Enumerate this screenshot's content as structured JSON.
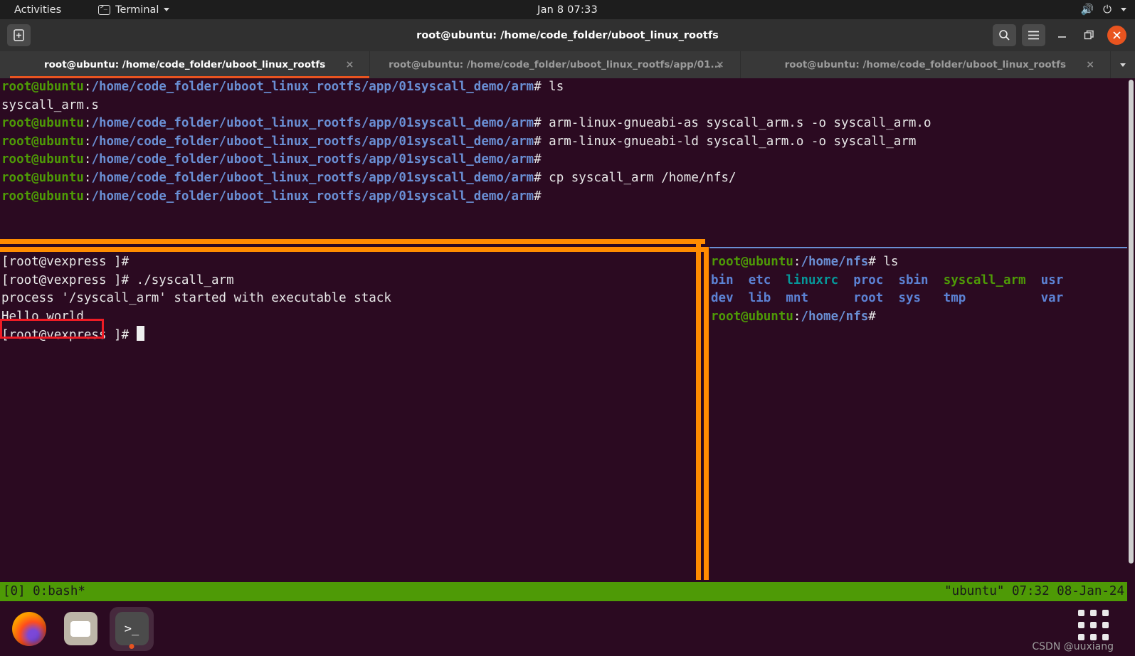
{
  "topbar": {
    "activities": "Activities",
    "app_name": "Terminal",
    "clock": "Jan 8 07:33",
    "volume_icon": "volume-icon",
    "power_icon": "power-icon",
    "caret_icon": "chevron-down-icon"
  },
  "window": {
    "title": "root@ubuntu: /home/code_folder/uboot_linux_rootfs",
    "new_tab_label": "+",
    "search_icon": "search-icon",
    "menu_icon": "hamburger-menu-icon",
    "minimize_label": "–",
    "maximize_label": "❐",
    "close_label": "✕",
    "accent_color": "#e95420"
  },
  "tabs": [
    {
      "label": "root@ubuntu: /home/code_folder/uboot_linux_rootfs",
      "close": "×",
      "active": true
    },
    {
      "label": "root@ubuntu: /home/code_folder/uboot_linux_rootfs/app/01...",
      "close": "×",
      "active": false
    },
    {
      "label": "root@ubuntu: /home/code_folder/uboot_linux_rootfs",
      "close": "×",
      "active": false
    }
  ],
  "tab_overflow_icon": "chevron-down-icon",
  "terminal": {
    "user_host": "root@ubuntu",
    "colon": ":",
    "path_host": "/home/code_folder/uboot_linux_rootfs/app/01syscall_demo/arm",
    "prompt_sym": "# ",
    "scrollback": [
      {
        "type": "prompt",
        "command": "ls"
      },
      {
        "type": "output",
        "text": "syscall_arm.s"
      },
      {
        "type": "prompt",
        "command": "arm-linux-gnueabi-as syscall_arm.s -o syscall_arm.o"
      },
      {
        "type": "prompt",
        "command": "arm-linux-gnueabi-ld syscall_arm.o -o syscall_arm"
      },
      {
        "type": "prompt",
        "command": ""
      },
      {
        "type": "prompt",
        "command": "cp syscall_arm /home/nfs/"
      },
      {
        "type": "prompt",
        "command": ""
      }
    ]
  },
  "pane_left": {
    "prompt": "[root@vexpress ]#",
    "lines": [
      {
        "prompt": "[root@vexpress ]#",
        "command": ""
      },
      {
        "prompt": "[root@vexpress ]#",
        "command": " ./syscall_arm"
      }
    ],
    "output_1": "process '/syscall_arm' started with executable stack",
    "output_highlighted": "Hello world",
    "final_prompt": "[root@vexpress ]#",
    "highlight_color": "#ee1c25"
  },
  "pane_right": {
    "user_host": "root@ubuntu",
    "colon": ":",
    "path": "/home/nfs",
    "prompt_sym": "# ",
    "command": "ls",
    "ls_row_1": [
      {
        "name": "bin",
        "kind": "dir"
      },
      {
        "name": "etc",
        "kind": "dir"
      },
      {
        "name": "linuxrc",
        "kind": "link"
      },
      {
        "name": "proc",
        "kind": "dir"
      },
      {
        "name": "sbin",
        "kind": "dir"
      },
      {
        "name": "syscall_arm",
        "kind": "exec"
      },
      {
        "name": "usr",
        "kind": "dir"
      }
    ],
    "ls_row_2": [
      {
        "name": "dev",
        "kind": "dir"
      },
      {
        "name": "lib",
        "kind": "dir"
      },
      {
        "name": "mnt",
        "kind": "dir"
      },
      {
        "name": "root",
        "kind": "dir"
      },
      {
        "name": "sys",
        "kind": "dir"
      },
      {
        "name": "tmp",
        "kind": "dir"
      },
      {
        "name": "var",
        "kind": "dir"
      }
    ],
    "ls_row_1_text": "bin  etc  linuxrc  proc  sbin  syscall_arm  usr",
    "ls_row_2_text": "dev  lib  mnt      root  sys   tmp          var",
    "final_prompt_path": "/home/nfs"
  },
  "tmux_status": {
    "left": "[0] 0:bash*",
    "right": "\"ubuntu\" 07:32 08-Jan-24",
    "bg_color": "#4e9a06"
  },
  "dock": {
    "items": [
      {
        "name": "firefox",
        "label": "Firefox",
        "active": false
      },
      {
        "name": "files",
        "label": "Files",
        "active": false
      },
      {
        "name": "terminal",
        "label": "Terminal",
        "active": true
      }
    ],
    "apps_grid_icon": "apps-grid-icon"
  },
  "watermark": "CSDN @uuxiang"
}
